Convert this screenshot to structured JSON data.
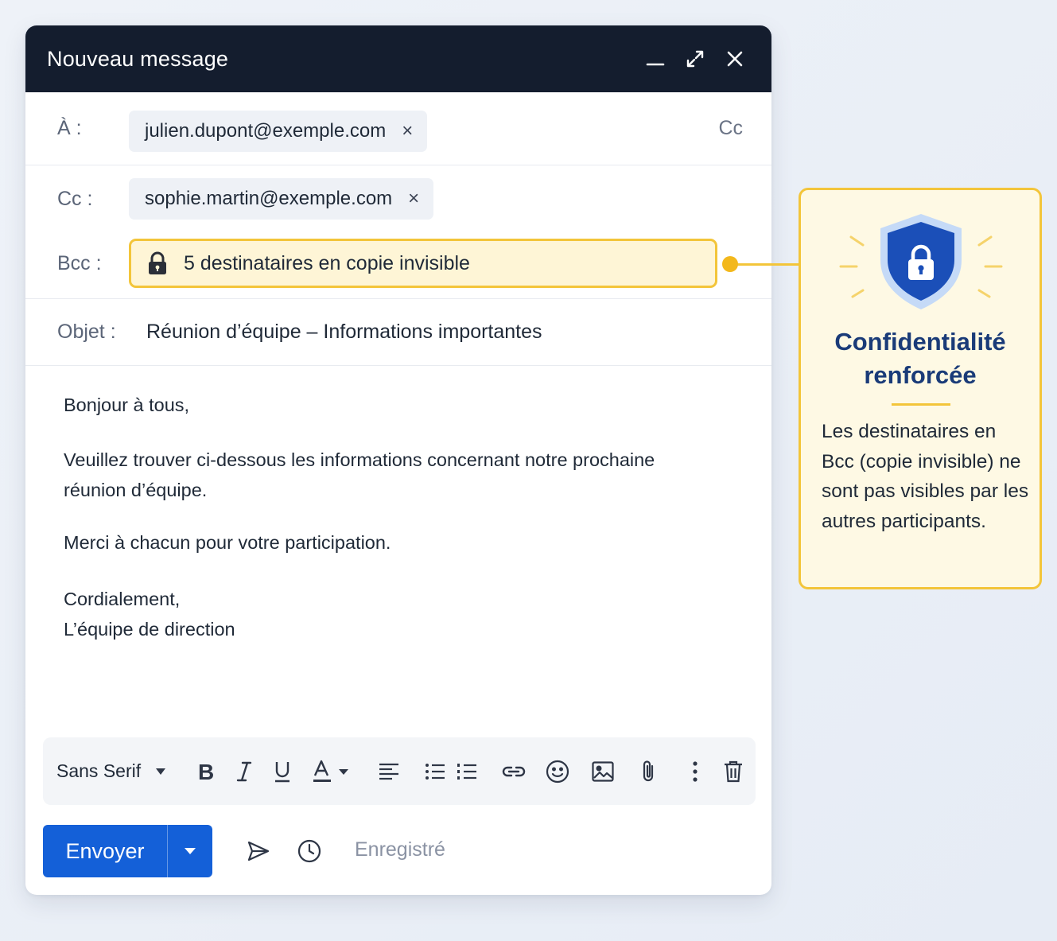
{
  "window": {
    "title": "Nouveau message",
    "controls": [
      "minimize-icon",
      "expand-icon",
      "close-icon"
    ]
  },
  "to": {
    "label": "À :",
    "recipient": "julien.dupont@exemple.com",
    "remove": "×",
    "cc_link": "Cc"
  },
  "cc": {
    "label": "Cc :",
    "recipient": "sophie.martin@exemple.com",
    "remove": "×"
  },
  "bcc": {
    "label": "Bcc :",
    "summary": "5 destinataires en copie invisible",
    "icon": "lock-icon"
  },
  "subject": {
    "label": "Objet :",
    "value": "Réunion d’équipe – Informations importantes"
  },
  "body": {
    "greeting": "Bonjour à tous,",
    "para1_line1": "Veuillez trouver ci-dessous les informations concernant notre prochaine",
    "para1_line2": "réunion d’équipe.",
    "para2": "Merci à chacun pour votre participation.",
    "closing": "Cordialement,",
    "signature": "L’équipe de direction"
  },
  "toolbar": {
    "font": "Sans Serif",
    "tools": [
      "bold-icon",
      "italic-icon",
      "underline-icon",
      "text-color-icon",
      "align-icon",
      "bulleted-list-icon",
      "numbered-list-icon",
      "link-icon",
      "emoji-icon",
      "image-icon",
      "attachment-icon",
      "more-options-icon",
      "delete-icon"
    ]
  },
  "footer": {
    "send_label": "Envoyer",
    "status": "Enregistré"
  },
  "callout": {
    "title": "Confidentialité renforcée",
    "text": "Les destinataires en Bcc (copie invisible) ne sont pas visibles par les autres participants.",
    "icon": "shield-lock-icon"
  },
  "colors": {
    "titlebar": "#141d2e",
    "send_button": "#1460d8",
    "highlight_border": "#f3c53a",
    "highlight_fill": "#fef5d6",
    "callout_title": "#1a3b78"
  }
}
